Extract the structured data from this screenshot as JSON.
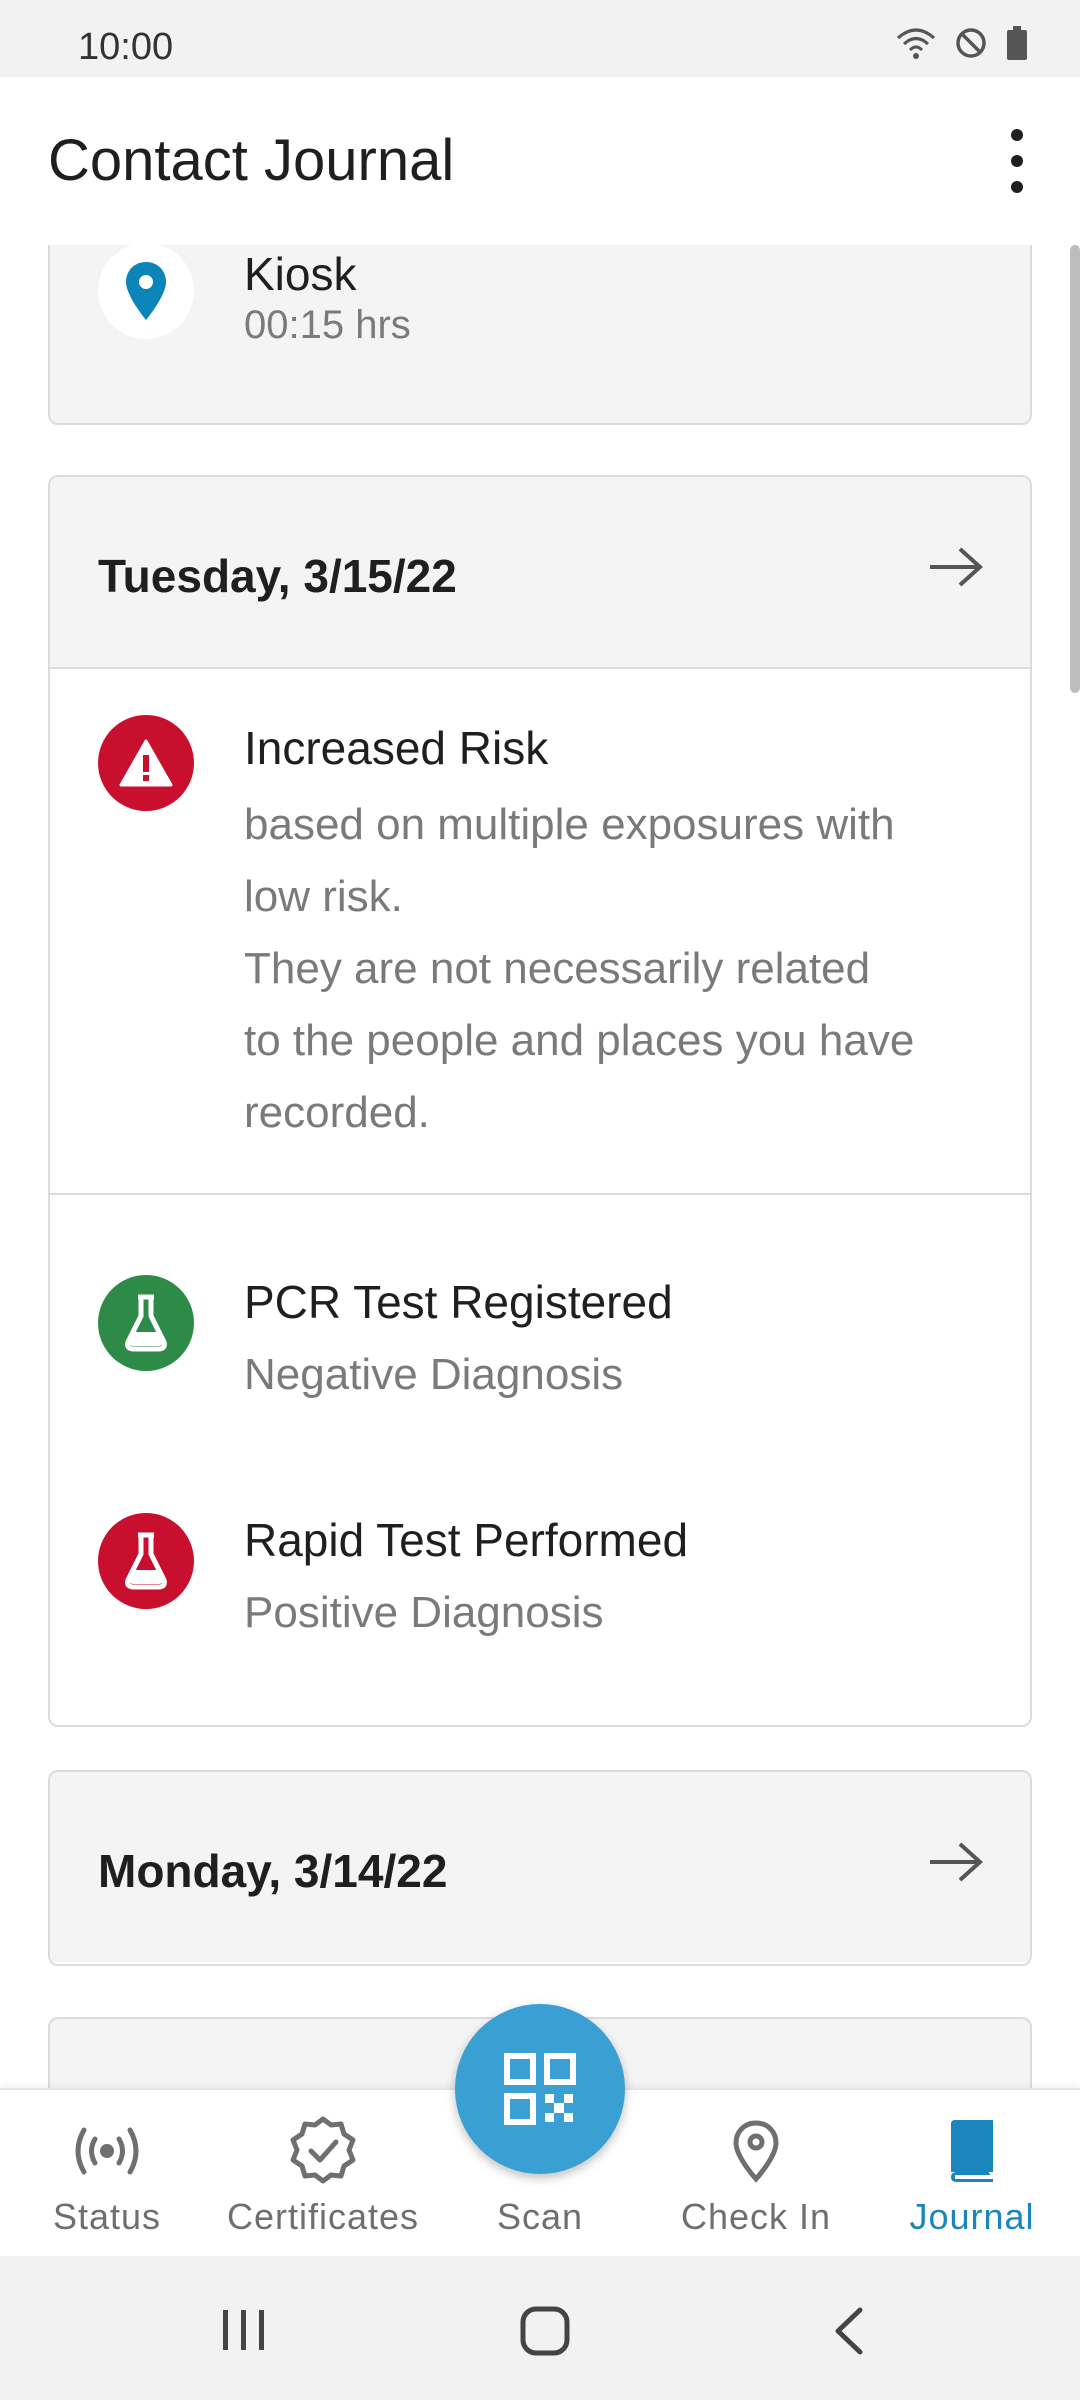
{
  "status_bar": {
    "time": "10:00"
  },
  "app_bar": {
    "title": "Contact Journal",
    "more_icon": "more-vert-icon"
  },
  "journal": {
    "partial_entry": {
      "title": "Kiosk",
      "duration": "00:15 hrs",
      "icon": "location-pin-icon",
      "icon_color": "#0b84b8"
    },
    "days": [
      {
        "date": "Tuesday, 3/15/22",
        "risk": {
          "title": "Increased Risk",
          "lines": [
            "based on multiple exposures with",
            "low risk.",
            "They are not necessarily related",
            "to the people and places you have",
            "recorded."
          ],
          "icon": "warning-icon",
          "color": "#c8102e"
        },
        "tests": [
          {
            "title": "PCR Test Registered",
            "result": "Negative Diagnosis",
            "icon": "flask-icon",
            "color": "#2e8b47"
          },
          {
            "title": "Rapid Test Performed",
            "result": "Positive Diagnosis",
            "icon": "flask-icon",
            "color": "#c8102e"
          }
        ]
      },
      {
        "date": "Monday, 3/14/22"
      }
    ]
  },
  "bottom_nav": {
    "items": [
      {
        "label": "Status",
        "icon": "broadcast-icon"
      },
      {
        "label": "Certificates",
        "icon": "certificate-icon"
      },
      {
        "label": "Scan",
        "icon": "qr-code-icon"
      },
      {
        "label": "Check In",
        "icon": "location-pin-icon"
      },
      {
        "label": "Journal",
        "icon": "book-icon"
      }
    ],
    "active": "Journal",
    "active_color": "#1a86bd"
  }
}
